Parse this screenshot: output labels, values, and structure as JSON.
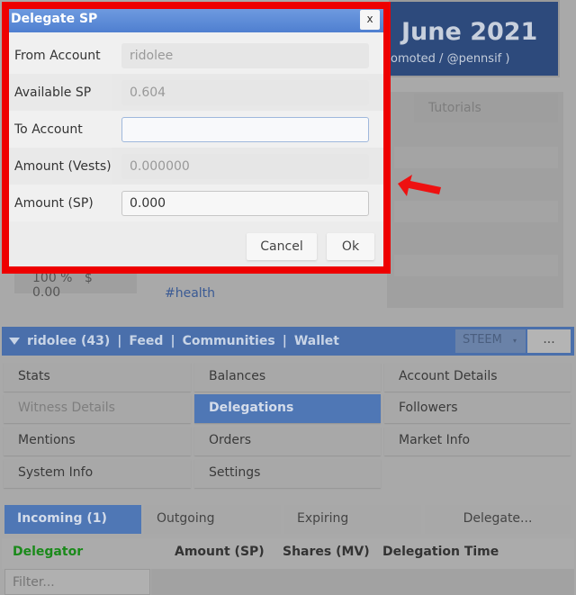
{
  "background": {
    "header_date": "June 2021",
    "header_sub": "omoted / @pennsif )",
    "tab_tutorials": "Tutorials",
    "percent": "100 %",
    "value": "$ 0.00",
    "tag": "#health"
  },
  "nav": {
    "account": "ridolee (43)",
    "links": [
      "Feed",
      "Communities",
      "Wallet"
    ],
    "separator": "|",
    "currency": "STEEM",
    "more": "..."
  },
  "menu": [
    {
      "label": "Stats",
      "state": "normal"
    },
    {
      "label": "Balances",
      "state": "normal"
    },
    {
      "label": "Account Details",
      "state": "normal"
    },
    {
      "label": "Witness Details",
      "state": "disabled"
    },
    {
      "label": "Delegations",
      "state": "selected"
    },
    {
      "label": "Followers",
      "state": "normal"
    },
    {
      "label": "Mentions",
      "state": "normal"
    },
    {
      "label": "Orders",
      "state": "normal"
    },
    {
      "label": "Market Info",
      "state": "normal"
    },
    {
      "label": "System Info",
      "state": "normal"
    },
    {
      "label": "Settings",
      "state": "normal"
    }
  ],
  "tabs": [
    "Incoming (1)",
    "Outgoing",
    "Expiring",
    "Delegate..."
  ],
  "table": {
    "headers": [
      "Delegator",
      "Amount (SP)",
      "Shares (MV)",
      "Delegation Time"
    ],
    "filter_placeholder": "Filter...",
    "delegator_color": "#1a8a1a"
  },
  "dialog": {
    "title": "Delegate SP",
    "close": "x",
    "fields": [
      {
        "label": "From Account",
        "value": "ridolee"
      },
      {
        "label": "Available SP",
        "value": "0.604"
      },
      {
        "label": "To Account",
        "value": ""
      },
      {
        "label": "Amount (Vests)",
        "value": "0.000000"
      },
      {
        "label": "Amount (SP)",
        "value": "0.000"
      }
    ],
    "cancel": "Cancel",
    "ok": "Ok"
  },
  "highlight_color": "#ee0000"
}
